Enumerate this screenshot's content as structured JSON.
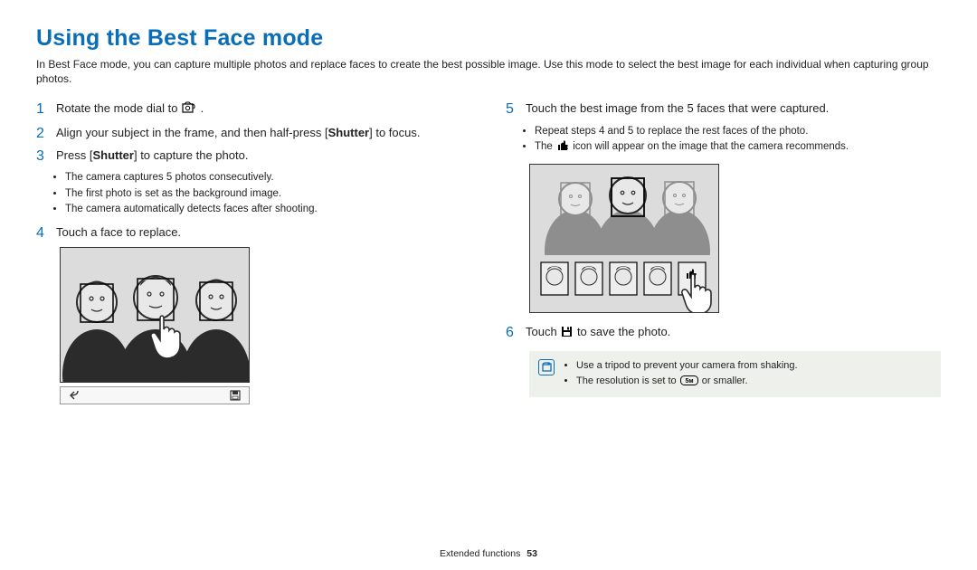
{
  "title": "Using the Best Face mode",
  "intro": "In Best Face mode, you can capture multiple photos and replace faces to create the best possible image. Use this mode to select the best image for each individual when capturing group photos.",
  "steps": {
    "s1": {
      "num": "1",
      "text_before": "Rotate the mode dial to ",
      "text_after": " ."
    },
    "s2": {
      "num": "2",
      "text_before": "Align your subject in the frame, and then half-press [",
      "bold": "Shutter",
      "text_after": "] to focus."
    },
    "s3": {
      "num": "3",
      "text_before": "Press [",
      "bold": "Shutter",
      "text_after": "] to capture the photo."
    },
    "s3_sub": [
      "The camera captures 5 photos consecutively.",
      "The first photo is set as the background image.",
      "The camera automatically detects faces after shooting."
    ],
    "s4": {
      "num": "4",
      "text": "Touch a face to replace."
    },
    "s5": {
      "num": "5",
      "text": "Touch the best image from the 5 faces that were captured."
    },
    "s5_sub_a": "Repeat steps 4 and 5 to replace the rest faces of the photo.",
    "s5_sub_b_before": "The ",
    "s5_sub_b_after": " icon will appear on the image that the camera recommends.",
    "s6": {
      "num": "6",
      "text_before": "Touch ",
      "text_after": " to save the photo."
    }
  },
  "note": {
    "a": "Use a tripod to prevent your camera from shaking.",
    "b_before": "The resolution is set to ",
    "b_after": " or smaller."
  },
  "footer": {
    "section": "Extended functions",
    "page": "53"
  }
}
